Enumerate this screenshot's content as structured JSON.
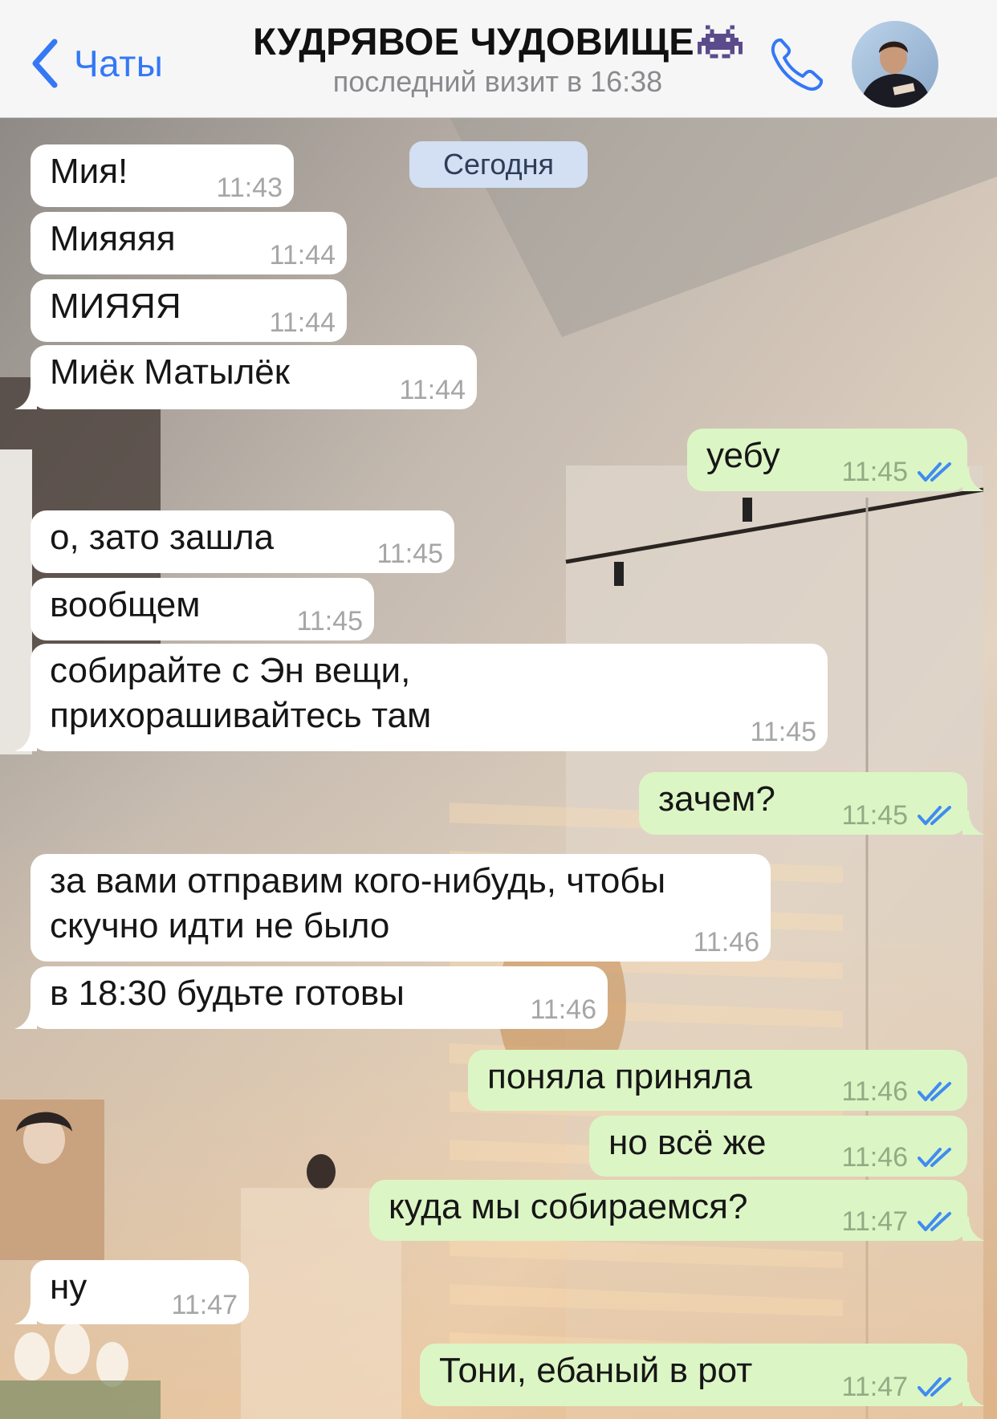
{
  "header": {
    "back_label": "Чаты",
    "title": "КУДРЯВОЕ ЧУДОВИЩЕ",
    "title_emoji": "alien-monster-icon",
    "subtitle": "последний визит в 16:38",
    "call_icon": "phone-icon",
    "avatar_icon": "contact-avatar"
  },
  "date_separator": "Сегодня",
  "messages": [
    {
      "dir": "in",
      "text": "Мия!",
      "time": "11:43"
    },
    {
      "dir": "in",
      "text": "Мияяяя",
      "time": "11:44"
    },
    {
      "dir": "in",
      "text": "МИЯЯЯ",
      "time": "11:44"
    },
    {
      "dir": "in",
      "text": "Миёк Матылёк",
      "time": "11:44"
    },
    {
      "dir": "out",
      "text": "уебу",
      "time": "11:45",
      "status": "read"
    },
    {
      "dir": "in",
      "text": "о, зато зашла",
      "time": "11:45"
    },
    {
      "dir": "in",
      "text": "вообщем",
      "time": "11:45"
    },
    {
      "dir": "in",
      "text": "собирайте с Эн вещи,\nприхорашивайтесь там",
      "time": "11:45"
    },
    {
      "dir": "out",
      "text": "зачем?",
      "time": "11:45",
      "status": "read"
    },
    {
      "dir": "in",
      "text": "за вами отправим кого-нибудь, чтобы\nскучно идти не было",
      "time": "11:46"
    },
    {
      "dir": "in",
      "text": "в 18:30 будьте готовы",
      "time": "11:46"
    },
    {
      "dir": "out",
      "text": "поняла приняла",
      "time": "11:46",
      "status": "read"
    },
    {
      "dir": "out",
      "text": "но всё же",
      "time": "11:46",
      "status": "read"
    },
    {
      "dir": "out",
      "text": "куда мы собираемся?",
      "time": "11:47",
      "status": "read"
    },
    {
      "dir": "in",
      "text": "ну",
      "time": "11:47"
    },
    {
      "dir": "out",
      "text": "Тони, ебаный в рот",
      "time": "11:47",
      "status": "read"
    }
  ],
  "colors": {
    "accent": "#3478f6",
    "incoming_bubble": "#ffffff",
    "outgoing_bubble": "#dcf5c5",
    "read_checks": "#3f8cf0",
    "date_pill": "#d3dff2"
  }
}
